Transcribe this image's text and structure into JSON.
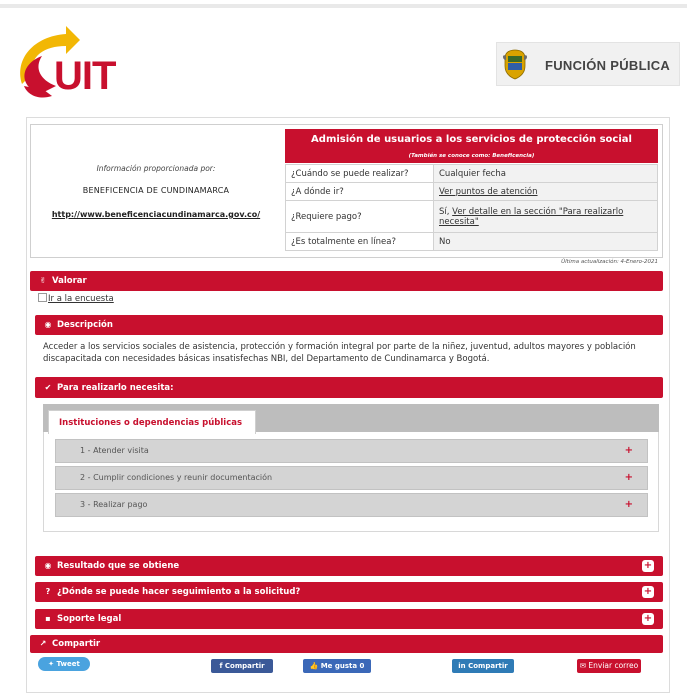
{
  "header": {
    "logo_text": "UIT",
    "entity_badge": "FUNCIÓN PÚBLICA"
  },
  "info": {
    "provided_by_label": "Información proporcionada por:",
    "entity_name": "BENEFICENCIA DE CUNDINAMARCA",
    "entity_url": "http://www.beneficenciacundinamarca.gov.co/"
  },
  "procedure": {
    "title": "Admisión de usuarios a los servicios de protección social",
    "also_known": "(También se conoce como: Beneficencia)",
    "rows": [
      {
        "q": "¿Cuándo se puede realizar?",
        "a": "Cualquier fecha"
      },
      {
        "q": "¿A dónde ir?",
        "a": "Ver puntos de atención"
      },
      {
        "q": "¿Requiere pago?",
        "a_prefix": "Sí, ",
        "a": "Ver detalle en la sección \"Para realizarlo necesita\""
      },
      {
        "q": "¿Es totalmente en línea?",
        "a": "No"
      }
    ],
    "last_update": "Última actualización: 4-Enero-2021"
  },
  "sections": {
    "valorar": "Valorar",
    "survey_link": "Ir a la encuesta",
    "descripcion": "Descripción",
    "descripcion_text": "Acceder a los servicios sociales de asistencia, protección y formación integral por parte de la niñez, juventud, adultos mayores y población discapacitada con necesidades básicas insatisfechas NBI, del Departamento de Cundinamarca y Bogotá.",
    "requisitos": "Para realizarlo necesita:",
    "resultado": "Resultado que se obtiene",
    "seguimiento": "¿Dónde se puede hacer seguimiento a la solicitud?",
    "soporte": "Soporte legal",
    "compartir": "Compartir"
  },
  "tabs": {
    "active": "Instituciones o dependencias públicas",
    "steps": [
      "1 - Atender visita",
      "2 - Cumplir condiciones y reunir documentación",
      "3 - Realizar pago"
    ]
  },
  "share": {
    "tweet": "Tweet",
    "facebook": "Compartir",
    "like": "Me gusta 0",
    "linkedin": "Compartir",
    "email": "Enviar correo"
  },
  "colors": {
    "brand_red": "#c8102e",
    "logo_yellow": "#f2b705"
  }
}
